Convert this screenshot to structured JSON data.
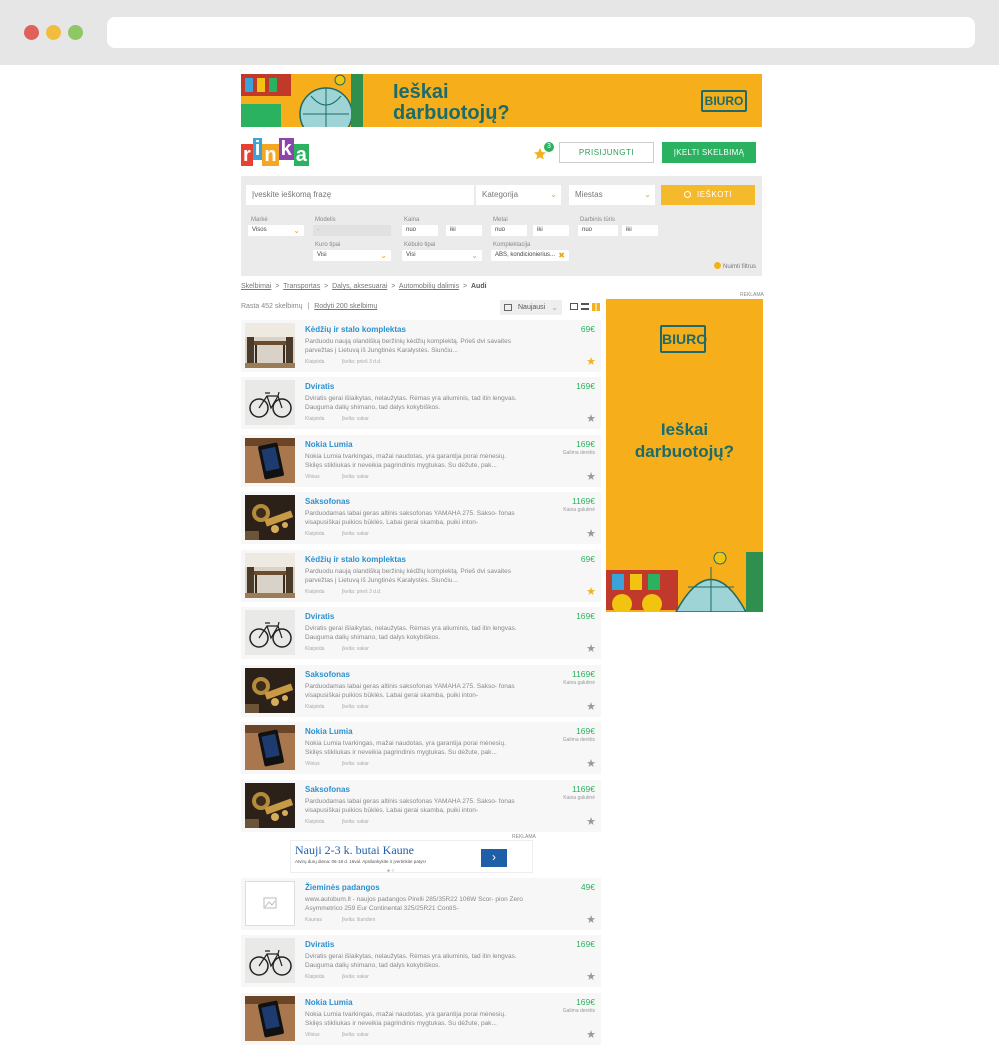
{
  "banner": {
    "line1": "Ieškai",
    "line2": "darbuotojų?",
    "brand": "BIURO"
  },
  "logo_letters": [
    "r",
    "i",
    "n",
    "k",
    "a"
  ],
  "logo_colors": [
    "#e9412f",
    "#3aa4da",
    "#f5a623",
    "#8e44ad",
    "#2bb260"
  ],
  "header": {
    "notifications_count": "3",
    "login_label": "PRISIJUNGTI",
    "post_label": "ĮKELTI SKELBIMĄ"
  },
  "search": {
    "placeholder": "Įveskite ieškomą frazę",
    "category": "Kategorija",
    "city": "Miestas",
    "button": "IEŠKOTI",
    "filters": {
      "marke_label": "Markė",
      "marke_value": "Visos",
      "modelis_label": "Modelis",
      "modelis_value": "-",
      "kaina_label": "Kaina",
      "kaina_from": "nuo",
      "kaina_to": "iki",
      "metai_label": "Metai",
      "metai_from": "nuo",
      "metai_to": "iki",
      "turis_label": "Darbinis tūris",
      "turis_from": "nuo",
      "turis_to": "iki",
      "kuras_label": "Kuro tipai",
      "kuras_value": "Visi",
      "kebulas_label": "Kėbulo tipai",
      "kebulas_value": "Visi",
      "komplektacija_label": "Komplektacija",
      "komplektacija_value": "ABS, kondicionierius...",
      "clear_label": "Nuimti filtrus"
    }
  },
  "breadcrumb": [
    "Skelbimai",
    "Transportas",
    "Dalys, aksesuarai",
    "Automobilių dalimis",
    "Audi"
  ],
  "results": {
    "found": "Rasta 452 skelbimų",
    "show_all": "Rodyti 200 skelbimų",
    "sort": "Naujausi"
  },
  "ad_label": "REKLAMA",
  "side_ad": {
    "line1": "Ieškai",
    "line2": "darbuotojų?",
    "brand": "BIURO"
  },
  "inline_ad": {
    "title": "Nauji 2-3 k. butai Kaune",
    "subtitle": "Atvirų durų diena: 06-18 d. 16val. Apsilankykite ir įvertinkite patys!"
  },
  "listings": [
    {
      "title": "Kėdžių ir stalo komplektas",
      "price": "69€",
      "note": "",
      "desc": "Parduodu naują olandišką beržinių kėdžių komplektą. Prieš dvi savaites parvežtas į Lietuvą iš Jungtinės Karalystės. Siunčiu...",
      "loc": "Klaipėda",
      "date": "Įkelta: prieš 3 d.d.",
      "fav": true,
      "img": "table"
    },
    {
      "title": "Dviratis",
      "price": "169€",
      "note": "",
      "desc": "Dviratis gerai išlaikytas, nelaužytas. Rėmas yra aliuminis, tad itin lengvas. Dauguma dalių shimano, tad dalys kokybiškos.",
      "loc": "Klaipėda",
      "date": "Įkelta: vakar",
      "fav": false,
      "img": "bike"
    },
    {
      "title": "Nokia Lumia",
      "price": "169€",
      "note": "Galima derėtis",
      "desc": "Nokia Lumia tvarkingas, mažai naudotas, yra garantija porai mėnesių. Skilęs stikliukas ir neveikia pagrindinis mygtukas. Su dėžute, pak...",
      "loc": "Vilnius",
      "date": "Įkelta: vakar",
      "fav": false,
      "img": "phone"
    },
    {
      "title": "Saksofonas",
      "price": "1169€",
      "note": "Kaina galutinė",
      "desc": "Parduodamas labai geras altinis saksofonas YAMAHA 275. Sakso- fonas visapusiškai puikios būklės. Labai gerai skamba, puiki inton-",
      "loc": "Klaipėda",
      "date": "Įkelta: vakar",
      "fav": false,
      "img": "sax"
    },
    {
      "title": "Kėdžių ir stalo komplektas",
      "price": "69€",
      "note": "",
      "desc": "Parduodu naują olandišką beržinių kėdžių komplektą. Prieš dvi savaites parvežtas į Lietuvą iš Jungtinės Karalystės. Siunčiu...",
      "loc": "Klaipėda",
      "date": "Įkelta: prieš 3 d.d.",
      "fav": true,
      "img": "table"
    },
    {
      "title": "Dviratis",
      "price": "169€",
      "note": "",
      "desc": "Dviratis gerai išlaikytas, nelaužytas. Rėmas yra aliuminis, tad itin lengvas. Dauguma dalių shimano, tad dalys kokybiškos.",
      "loc": "Klaipėda",
      "date": "Įkelta: vakar",
      "fav": false,
      "img": "bike"
    },
    {
      "title": "Saksofonas",
      "price": "1169€",
      "note": "Kaina galutinė",
      "desc": "Parduodamas labai geras altinis saksofonas YAMAHA 275. Sakso- fonas visapusiškai puikios būklės. Labai gerai skamba, puiki inton-",
      "loc": "Klaipėda",
      "date": "Įkelta: vakar",
      "fav": false,
      "img": "sax"
    },
    {
      "title": "Nokia Lumia",
      "price": "169€",
      "note": "Galima derėtis",
      "desc": "Nokia Lumia tvarkingas, mažai naudotas, yra garantija porai mėnesių. Skilęs stikliukas ir neveikia pagrindinis mygtukas. Su dėžute, pak...",
      "loc": "Vilnius",
      "date": "Įkelta: vakar",
      "fav": false,
      "img": "phone"
    },
    {
      "title": "Saksofonas",
      "price": "1169€",
      "note": "Kaina galutinė",
      "desc": "Parduodamas labai geras altinis saksofonas YAMAHA 275. Sakso- fonas visapusiškai puikios būklės. Labai gerai skamba, puiki inton-",
      "loc": "Klaipėda",
      "date": "Įkelta: vakar",
      "fav": false,
      "img": "sax"
    },
    {
      "title": "Žieminės padangos",
      "price": "49€",
      "note": "",
      "desc": "www.autobum.lt - naujos padangos Pirelli 285/35R22 106W Scor- pion Zero Asymmetrico 259 Eur Continental 325/25R21 ContiS-",
      "loc": "Kaunas",
      "date": "Įkelta: šiandien",
      "fav": false,
      "img": "none"
    },
    {
      "title": "Dviratis",
      "price": "169€",
      "note": "",
      "desc": "Dviratis gerai išlaikytas, nelaužytas. Rėmas yra aliuminis, tad itin lengvas. Dauguma dalių shimano, tad dalys kokybiškos.",
      "loc": "Klaipėda",
      "date": "Įkelta: vakar",
      "fav": false,
      "img": "bike"
    },
    {
      "title": "Nokia Lumia",
      "price": "169€",
      "note": "Galima derėtis",
      "desc": "Nokia Lumia tvarkingas, mažai naudotas, yra garantija porai mėnesių. Skilęs stikliukas ir neveikia pagrindinis mygtukas. Su dėžute, pak...",
      "loc": "Vilnius",
      "date": "Įkelta: vakar",
      "fav": false,
      "img": "phone"
    }
  ]
}
